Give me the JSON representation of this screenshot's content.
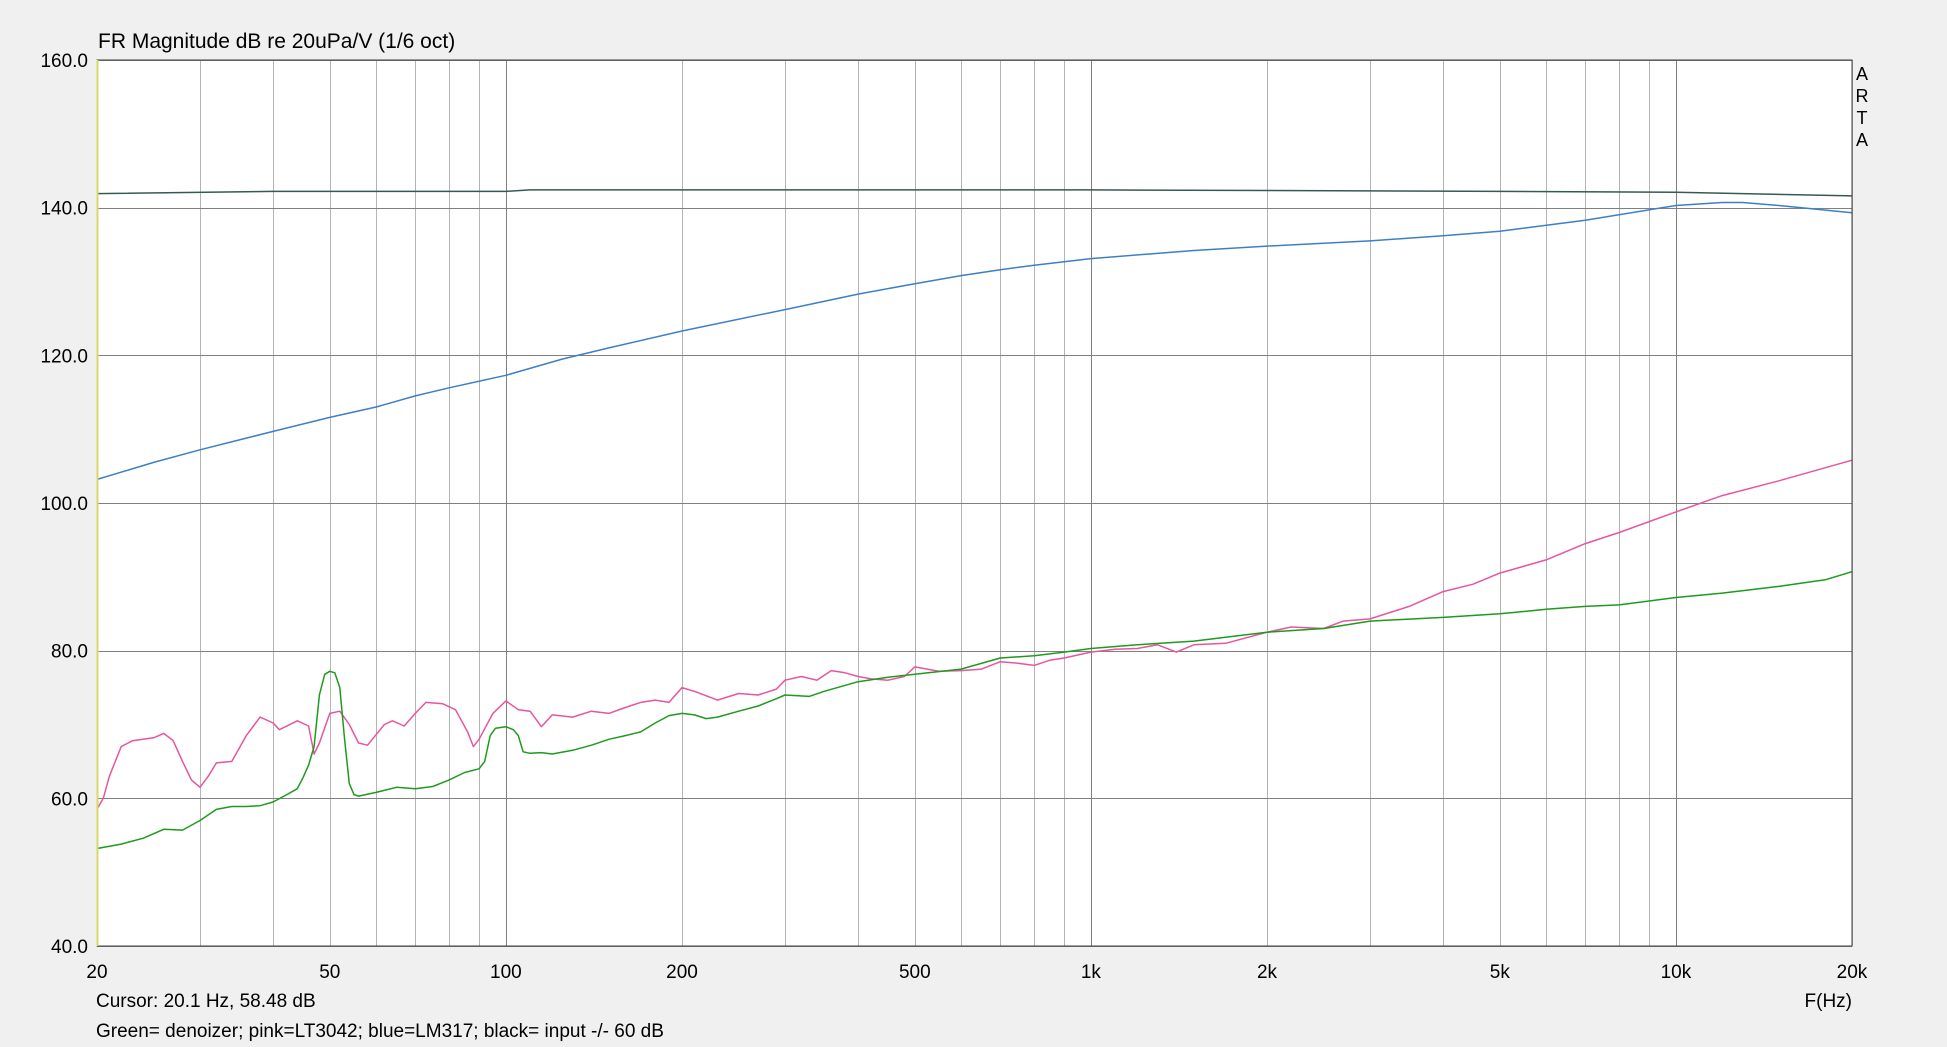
{
  "window": {
    "title": "FR Magnitude dB re 20uPa/V (1/6 oct)",
    "watermark": [
      "A",
      "R",
      "T",
      "A"
    ],
    "cursor_readout": "Cursor: 20.1 Hz, 58.48 dB",
    "xaxis_unit": "F(Hz)",
    "legend_note": "Green= denoizer; pink=LT3042; blue=LM317; black= input -/- 60 dB"
  },
  "colors": {
    "background": "#f0f0f0",
    "plot_area": "#ffffff",
    "grid": "#b4b4b4",
    "major_grid": "#808080",
    "green": "#1e9a1e",
    "pink": "#e8559f",
    "blue": "#3d7fc7",
    "black": "#355a55"
  },
  "chart_data": {
    "type": "line",
    "title": "FR Magnitude dB re 20uPa/V (1/6 oct)",
    "xlabel": "F(Hz)",
    "ylabel": "",
    "xscale": "log",
    "xlim": [
      20,
      20000
    ],
    "ylim": [
      40,
      160
    ],
    "grid": true,
    "x_ticks": [
      {
        "value": 20,
        "label": "20"
      },
      {
        "value": 50,
        "label": "50"
      },
      {
        "value": 100,
        "label": "100"
      },
      {
        "value": 200,
        "label": "200"
      },
      {
        "value": 500,
        "label": "500"
      },
      {
        "value": 1000,
        "label": "1k"
      },
      {
        "value": 2000,
        "label": "2k"
      },
      {
        "value": 5000,
        "label": "5k"
      },
      {
        "value": 10000,
        "label": "10k"
      },
      {
        "value": 20000,
        "label": "20k"
      }
    ],
    "x_grid": [
      30,
      40,
      60,
      70,
      80,
      90,
      300,
      400,
      600,
      700,
      800,
      900,
      3000,
      4000,
      6000,
      7000,
      8000,
      9000
    ],
    "x_major_grid": [
      100,
      1000,
      10000
    ],
    "y_ticks": [
      {
        "value": 40,
        "label": "40.0"
      },
      {
        "value": 60,
        "label": "60.0"
      },
      {
        "value": 80,
        "label": "80.0"
      },
      {
        "value": 100,
        "label": "100.0"
      },
      {
        "value": 120,
        "label": "120.0"
      },
      {
        "value": 140,
        "label": "140.0"
      },
      {
        "value": 160,
        "label": "160.0"
      }
    ],
    "series": [
      {
        "color_key": "black",
        "points": [
          [
            20,
            141.9
          ],
          [
            40,
            142.2
          ],
          [
            100,
            142.2
          ],
          [
            110,
            142.4
          ],
          [
            1000,
            142.4
          ],
          [
            5000,
            142.2
          ],
          [
            10000,
            142.1
          ],
          [
            20000,
            141.6
          ]
        ]
      },
      {
        "color_key": "blue",
        "points": [
          [
            20,
            103.2
          ],
          [
            25,
            105.5
          ],
          [
            30,
            107.2
          ],
          [
            40,
            109.7
          ],
          [
            50,
            111.6
          ],
          [
            60,
            113.0
          ],
          [
            70,
            114.5
          ],
          [
            80,
            115.6
          ],
          [
            100,
            117.3
          ],
          [
            125,
            119.5
          ],
          [
            150,
            121.0
          ],
          [
            200,
            123.3
          ],
          [
            300,
            126.2
          ],
          [
            400,
            128.3
          ],
          [
            500,
            129.7
          ],
          [
            600,
            130.8
          ],
          [
            700,
            131.6
          ],
          [
            800,
            132.2
          ],
          [
            1000,
            133.1
          ],
          [
            1500,
            134.2
          ],
          [
            2000,
            134.8
          ],
          [
            3000,
            135.5
          ],
          [
            4000,
            136.2
          ],
          [
            5000,
            136.8
          ],
          [
            7000,
            138.3
          ],
          [
            10000,
            140.3
          ],
          [
            12000,
            140.7
          ],
          [
            13000,
            140.7
          ],
          [
            15000,
            140.3
          ],
          [
            20000,
            139.3
          ]
        ]
      },
      {
        "color_key": "pink",
        "points": [
          [
            20,
            58.5
          ],
          [
            20.5,
            60.0
          ],
          [
            21,
            63.0
          ],
          [
            22,
            67.0
          ],
          [
            23,
            67.8
          ],
          [
            25,
            68.2
          ],
          [
            26,
            68.8
          ],
          [
            27,
            67.8
          ],
          [
            28,
            65.0
          ],
          [
            29,
            62.5
          ],
          [
            30,
            61.5
          ],
          [
            31,
            63.0
          ],
          [
            32,
            64.8
          ],
          [
            34,
            65.0
          ],
          [
            36,
            68.5
          ],
          [
            38,
            71.0
          ],
          [
            40,
            70.2
          ],
          [
            41,
            69.3
          ],
          [
            44,
            70.5
          ],
          [
            46,
            69.8
          ],
          [
            47,
            66.0
          ],
          [
            48,
            67.5
          ],
          [
            50,
            71.5
          ],
          [
            52,
            71.8
          ],
          [
            54,
            70.0
          ],
          [
            56,
            67.5
          ],
          [
            58,
            67.2
          ],
          [
            62,
            70.0
          ],
          [
            64,
            70.5
          ],
          [
            67,
            69.8
          ],
          [
            70,
            71.5
          ],
          [
            73,
            73.0
          ],
          [
            78,
            72.8
          ],
          [
            82,
            72.0
          ],
          [
            86,
            69.0
          ],
          [
            88,
            67.0
          ],
          [
            90,
            68.0
          ],
          [
            95,
            71.5
          ],
          [
            100,
            73.2
          ],
          [
            105,
            72.0
          ],
          [
            110,
            71.8
          ],
          [
            115,
            69.7
          ],
          [
            120,
            71.3
          ],
          [
            130,
            71.0
          ],
          [
            140,
            71.8
          ],
          [
            150,
            71.5
          ],
          [
            160,
            72.3
          ],
          [
            170,
            73.0
          ],
          [
            180,
            73.3
          ],
          [
            190,
            73.0
          ],
          [
            200,
            75.0
          ],
          [
            210,
            74.5
          ],
          [
            230,
            73.3
          ],
          [
            250,
            74.2
          ],
          [
            270,
            74.0
          ],
          [
            290,
            74.8
          ],
          [
            300,
            76.0
          ],
          [
            320,
            76.5
          ],
          [
            340,
            76.0
          ],
          [
            360,
            77.3
          ],
          [
            380,
            77.0
          ],
          [
            400,
            76.5
          ],
          [
            420,
            76.2
          ],
          [
            450,
            76.0
          ],
          [
            480,
            76.5
          ],
          [
            500,
            77.8
          ],
          [
            550,
            77.2
          ],
          [
            600,
            77.3
          ],
          [
            650,
            77.5
          ],
          [
            700,
            78.5
          ],
          [
            750,
            78.3
          ],
          [
            800,
            78.0
          ],
          [
            850,
            78.7
          ],
          [
            900,
            79.0
          ],
          [
            1000,
            79.8
          ],
          [
            1100,
            80.2
          ],
          [
            1200,
            80.3
          ],
          [
            1300,
            80.8
          ],
          [
            1400,
            79.8
          ],
          [
            1500,
            80.8
          ],
          [
            1700,
            81.0
          ],
          [
            2000,
            82.5
          ],
          [
            2200,
            83.2
          ],
          [
            2500,
            83.0
          ],
          [
            2700,
            84.0
          ],
          [
            3000,
            84.3
          ],
          [
            3500,
            86.0
          ],
          [
            4000,
            88.0
          ],
          [
            4500,
            89.0
          ],
          [
            5000,
            90.5
          ],
          [
            6000,
            92.3
          ],
          [
            7000,
            94.5
          ],
          [
            8000,
            96.0
          ],
          [
            10000,
            98.8
          ],
          [
            12000,
            101.0
          ],
          [
            15000,
            103.0
          ],
          [
            20000,
            105.8
          ]
        ]
      },
      {
        "color_key": "green",
        "points": [
          [
            20,
            53.2
          ],
          [
            22,
            53.8
          ],
          [
            24,
            54.6
          ],
          [
            26,
            55.8
          ],
          [
            28,
            55.7
          ],
          [
            30,
            57.0
          ],
          [
            32,
            58.5
          ],
          [
            34,
            58.9
          ],
          [
            36,
            58.9
          ],
          [
            38,
            59.0
          ],
          [
            40,
            59.5
          ],
          [
            42,
            60.4
          ],
          [
            44,
            61.3
          ],
          [
            45,
            62.8
          ],
          [
            46,
            64.5
          ],
          [
            47,
            67.0
          ],
          [
            48,
            74.0
          ],
          [
            49,
            76.8
          ],
          [
            50,
            77.2
          ],
          [
            51,
            77.0
          ],
          [
            52,
            75.0
          ],
          [
            53,
            68.0
          ],
          [
            54,
            62.0
          ],
          [
            55,
            60.5
          ],
          [
            56,
            60.3
          ],
          [
            60,
            60.8
          ],
          [
            65,
            61.5
          ],
          [
            70,
            61.3
          ],
          [
            75,
            61.6
          ],
          [
            80,
            62.5
          ],
          [
            85,
            63.5
          ],
          [
            90,
            64.0
          ],
          [
            92,
            65.0
          ],
          [
            94,
            68.5
          ],
          [
            96,
            69.5
          ],
          [
            100,
            69.7
          ],
          [
            103,
            69.3
          ],
          [
            105,
            68.5
          ],
          [
            107,
            66.3
          ],
          [
            110,
            66.1
          ],
          [
            115,
            66.2
          ],
          [
            120,
            66.0
          ],
          [
            130,
            66.5
          ],
          [
            140,
            67.2
          ],
          [
            150,
            68.0
          ],
          [
            160,
            68.5
          ],
          [
            170,
            69.0
          ],
          [
            180,
            70.2
          ],
          [
            190,
            71.2
          ],
          [
            200,
            71.5
          ],
          [
            210,
            71.3
          ],
          [
            220,
            70.8
          ],
          [
            230,
            71.0
          ],
          [
            250,
            71.8
          ],
          [
            270,
            72.5
          ],
          [
            290,
            73.5
          ],
          [
            300,
            74.0
          ],
          [
            330,
            73.8
          ],
          [
            350,
            74.5
          ],
          [
            400,
            75.8
          ],
          [
            450,
            76.4
          ],
          [
            500,
            76.8
          ],
          [
            600,
            77.5
          ],
          [
            700,
            79.0
          ],
          [
            800,
            79.3
          ],
          [
            900,
            79.8
          ],
          [
            1000,
            80.3
          ],
          [
            1200,
            80.8
          ],
          [
            1500,
            81.3
          ],
          [
            2000,
            82.5
          ],
          [
            2500,
            83.0
          ],
          [
            3000,
            84.0
          ],
          [
            4000,
            84.5
          ],
          [
            5000,
            85.0
          ],
          [
            6000,
            85.6
          ],
          [
            7000,
            86.0
          ],
          [
            8000,
            86.2
          ],
          [
            10000,
            87.2
          ],
          [
            12000,
            87.8
          ],
          [
            15000,
            88.7
          ],
          [
            18000,
            89.6
          ],
          [
            20000,
            90.7
          ]
        ]
      }
    ]
  }
}
